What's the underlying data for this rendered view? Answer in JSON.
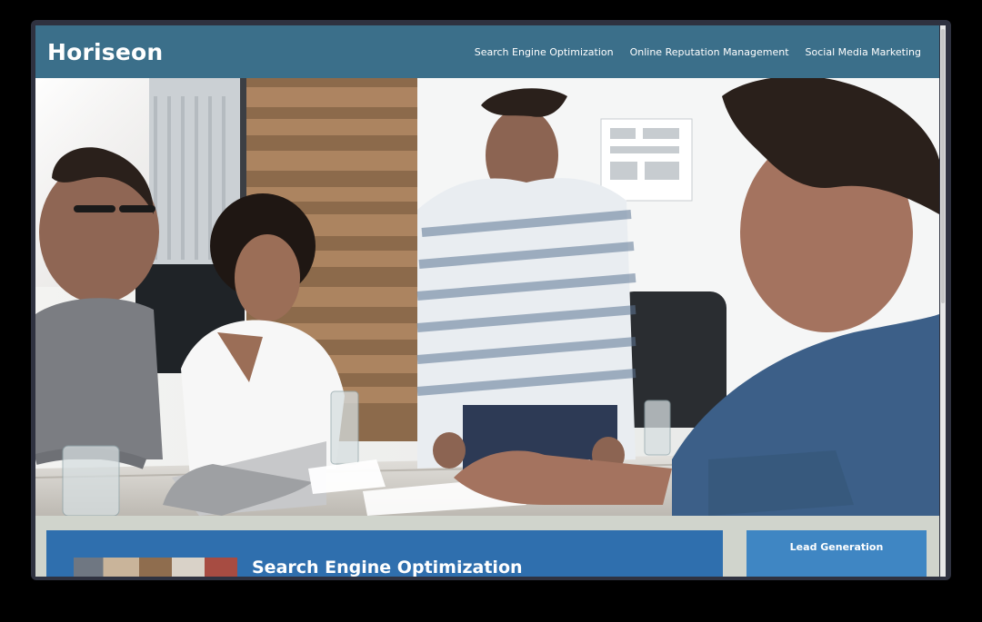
{
  "header": {
    "logo": "Horiseon",
    "nav": [
      {
        "label": "Search Engine Optimization"
      },
      {
        "label": "Online Reputation Management"
      },
      {
        "label": "Social Media Marketing"
      }
    ]
  },
  "hero": {
    "icon": "office-meeting-photo"
  },
  "content": {
    "main_card": {
      "title": "Search Engine Optimization"
    },
    "side_card": {
      "title": "Lead Generation"
    }
  },
  "colors": {
    "header_bg": "#3b6f8a",
    "main_card_bg": "#2f6fae",
    "side_card_bg": "#3f86c3",
    "page_bg": "#d0d4cc"
  }
}
